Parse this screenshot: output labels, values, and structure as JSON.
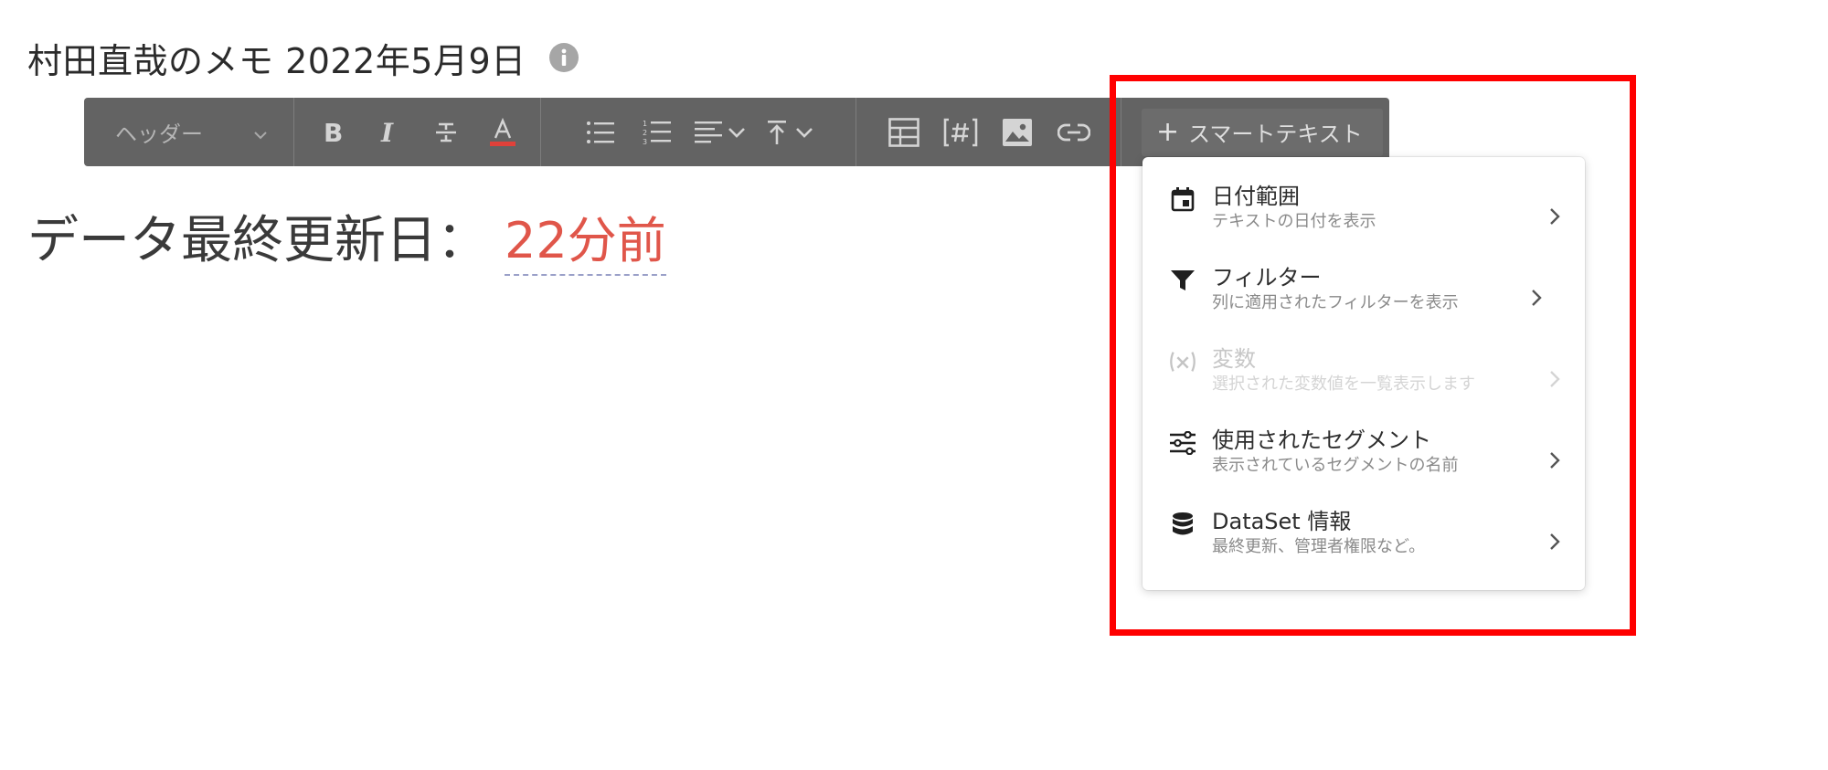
{
  "title": "村田直哉のメモ 2022年5月9日",
  "toolbar": {
    "header_select_label": "ヘッダー",
    "smart_text_label": "スマートテキスト",
    "smart_text_plus": "+"
  },
  "content": {
    "label": "データ最終更新日：",
    "value": "22分前"
  },
  "dropdown": {
    "items": [
      {
        "label": "日付範囲",
        "desc": "テキストの日付を表示"
      },
      {
        "label": "フィルター",
        "desc": "列に適用されたフィルターを表示"
      },
      {
        "label": "変数",
        "desc": "選択された変数値を一覧表示します"
      },
      {
        "label": "使用されたセグメント",
        "desc": "表示されているセグメントの名前"
      },
      {
        "label": "DataSet 情報",
        "desc": "最終更新、管理者権限など。"
      }
    ]
  },
  "colors": {
    "toolbar_bg": "#636363",
    "accent_red": "#e0564a",
    "highlight": "#ff0000"
  }
}
